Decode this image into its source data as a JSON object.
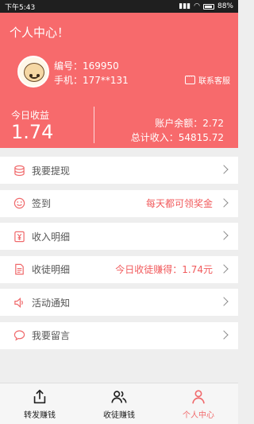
{
  "statusbar": {
    "time": "下午5:43",
    "battery": "88%"
  },
  "header": {
    "title": "个人中心！",
    "user_id": "编号：169950",
    "phone": "手机：177**131",
    "contact": "联系客服",
    "today_label": "今日收益",
    "today_value": "1.74",
    "balance": "账户余额：2.72",
    "total_income": "总计收入：54815.72"
  },
  "menu": {
    "items": [
      {
        "label": "我要提现",
        "extra": "",
        "icon": "coins-icon"
      },
      {
        "label": "签到",
        "extra": "每天都可领奖金",
        "icon": "smile-icon"
      },
      {
        "label": "收入明细",
        "extra": "",
        "icon": "yen-icon"
      },
      {
        "label": "收徒明细",
        "extra": "今日收徒赚得：1.74元",
        "icon": "document-icon"
      },
      {
        "label": "活动通知",
        "extra": "",
        "icon": "speaker-icon"
      },
      {
        "label": "我要留言",
        "extra": "",
        "icon": "chat-bubble-icon"
      }
    ]
  },
  "tabs": [
    {
      "label": "转发赚钱",
      "icon": "share-icon"
    },
    {
      "label": "收徒赚钱",
      "icon": "users-icon"
    },
    {
      "label": "个人中心",
      "icon": "person-icon"
    }
  ],
  "colors": {
    "accent": "#f76a6c",
    "tab_active": "#f06a6c"
  }
}
